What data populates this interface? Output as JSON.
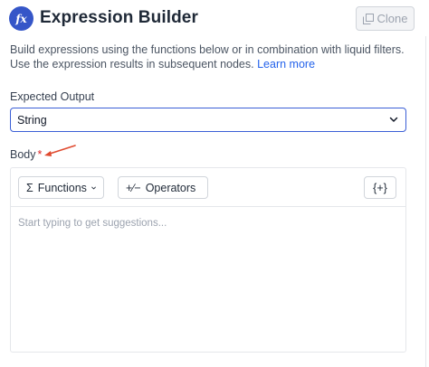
{
  "header": {
    "title": "Expression Builder",
    "icon": "function-icon",
    "icon_glyph": "fx",
    "clone_label": "Clone"
  },
  "description": {
    "text": "Build expressions using the functions below or in combination with liquid filters. Use the expression results in subsequent nodes.",
    "link_text": "Learn more"
  },
  "expected_output": {
    "label": "Expected Output",
    "selected": "String"
  },
  "body": {
    "label": "Body",
    "required_marker": "*",
    "toolbar": {
      "functions_icon": "Σ",
      "functions_label": "Functions",
      "operators_icon": "+∕−",
      "operators_label": "Operators",
      "braces_label": "{+}"
    },
    "placeholder": "Start typing to get suggestions..."
  },
  "colors": {
    "accent": "#3556c8",
    "link": "#2563eb",
    "annotation_arrow": "#e04a2f",
    "required": "#dc2626"
  }
}
